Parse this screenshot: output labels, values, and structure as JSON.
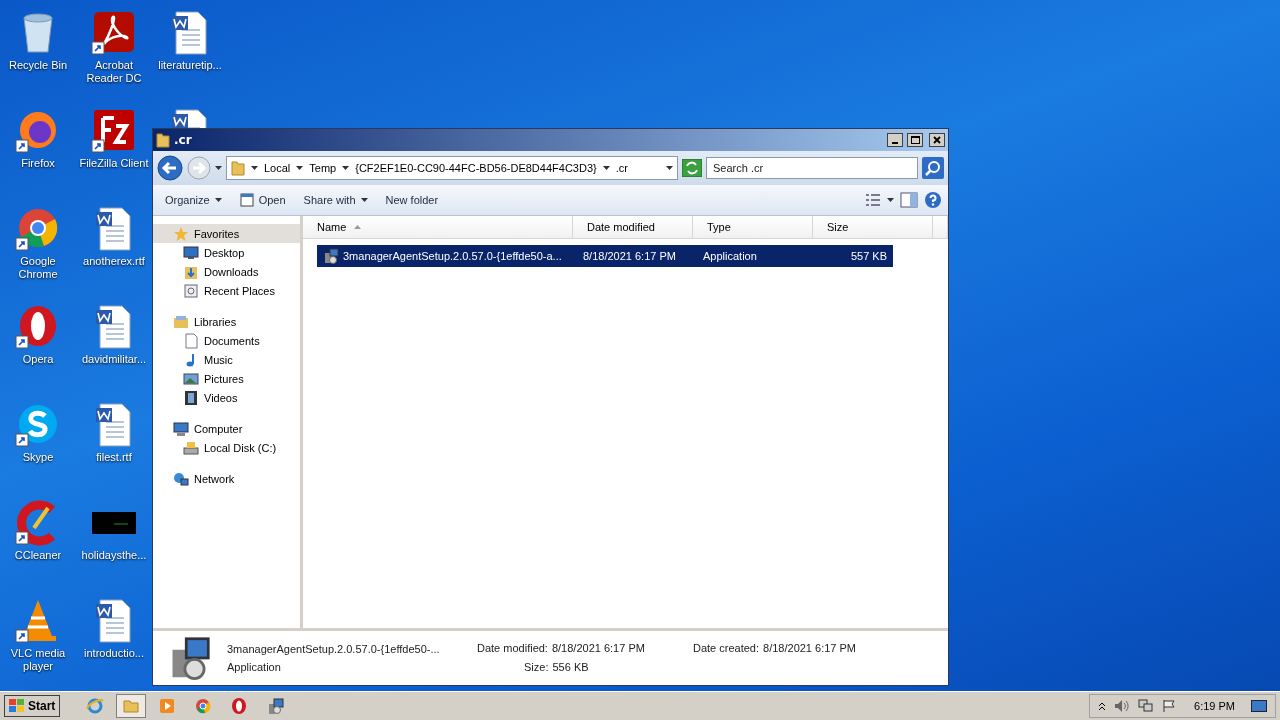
{
  "desktop": {
    "icons": [
      {
        "label": "Recycle Bin",
        "kind": "recycle",
        "shortcut": false
      },
      {
        "label": "Firefox",
        "kind": "firefox",
        "shortcut": true
      },
      {
        "label": "Google Chrome",
        "kind": "chrome",
        "shortcut": true
      },
      {
        "label": "Opera",
        "kind": "opera",
        "shortcut": true
      },
      {
        "label": "Skype",
        "kind": "skype",
        "shortcut": true
      },
      {
        "label": "CCleaner",
        "kind": "ccleaner",
        "shortcut": true
      },
      {
        "label": "VLC media player",
        "kind": "vlc",
        "shortcut": true
      },
      {
        "label": "Acrobat Reader DC",
        "kind": "acrobat",
        "shortcut": true
      },
      {
        "label": "FileZilla Client",
        "kind": "filezilla",
        "shortcut": true
      },
      {
        "label": "anotherex.rtf",
        "kind": "word",
        "shortcut": false
      },
      {
        "label": "davidmilitar...",
        "kind": "word",
        "shortcut": false
      },
      {
        "label": "filest.rtf",
        "kind": "word",
        "shortcut": false
      },
      {
        "label": "holidaysthe...",
        "kind": "image",
        "shortcut": false
      },
      {
        "label": "introductio...",
        "kind": "word",
        "shortcut": false
      },
      {
        "label": "literaturetip...",
        "kind": "word",
        "shortcut": false
      },
      {
        "kind": "word"
      }
    ]
  },
  "window": {
    "title": ".cr",
    "address": [
      "Local",
      "Temp",
      "{CF2EF1E0-CC90-44FC-BD56-DE8D44F4C3D3}",
      ".cr"
    ],
    "search": {
      "placeholder": "Search .cr"
    },
    "toolbar": [
      {
        "label": "Organize",
        "kind": "menu"
      },
      {
        "label": "Open",
        "kind": "open"
      },
      {
        "label": "Share with",
        "kind": "menu"
      },
      {
        "label": "New folder",
        "kind": "plain"
      }
    ],
    "nav": [
      {
        "label": "Favorites",
        "kind": "star",
        "selected": true,
        "children": [
          {
            "label": "Desktop",
            "kind": "desktop",
            "selected": false
          },
          {
            "label": "Downloads",
            "kind": "downloads",
            "selected": false
          },
          {
            "label": "Recent Places",
            "kind": "recent",
            "selected": false
          }
        ]
      },
      {
        "label": "Libraries",
        "kind": "libraries",
        "selected": false,
        "children": [
          {
            "label": "Documents",
            "kind": "documents",
            "selected": false
          },
          {
            "label": "Music",
            "kind": "music",
            "selected": false
          },
          {
            "label": "Pictures",
            "kind": "pictures",
            "selected": false
          },
          {
            "label": "Videos",
            "kind": "videos",
            "selected": false
          }
        ]
      },
      {
        "label": "Computer",
        "kind": "computer",
        "selected": false,
        "children": [
          {
            "label": "Local Disk (C:)",
            "kind": "disk",
            "selected": false
          }
        ]
      },
      {
        "label": "Network",
        "kind": "network",
        "selected": false
      }
    ],
    "columns": [
      "Name",
      "Date modified",
      "Type",
      "Size"
    ],
    "rows": [
      {
        "name": "3managerAgentSetup.2.0.57.0-{1effde50-a...",
        "date": "8/18/2021 6:17 PM",
        "type": "Application",
        "size": "557 KB",
        "selected": true
      }
    ],
    "details": {
      "name": "3managerAgentSetup.2.0.57.0-{1effde50-...",
      "type": "Application",
      "modified_label": "Date modified:",
      "modified": "8/18/2021 6:17 PM",
      "size_label": "Size:",
      "size": "556 KB",
      "created_label": "Date created:",
      "created": "8/18/2021 6:17 PM"
    }
  },
  "taskbar": {
    "start": "Start",
    "apps": [
      {
        "kind": "ie",
        "selected": false
      },
      {
        "kind": "explorer",
        "selected": true
      },
      {
        "kind": "media",
        "selected": false
      },
      {
        "kind": "chrome",
        "selected": false
      },
      {
        "kind": "opera",
        "selected": false
      },
      {
        "kind": "installer",
        "selected": false
      }
    ],
    "clock": "6:19 PM"
  }
}
